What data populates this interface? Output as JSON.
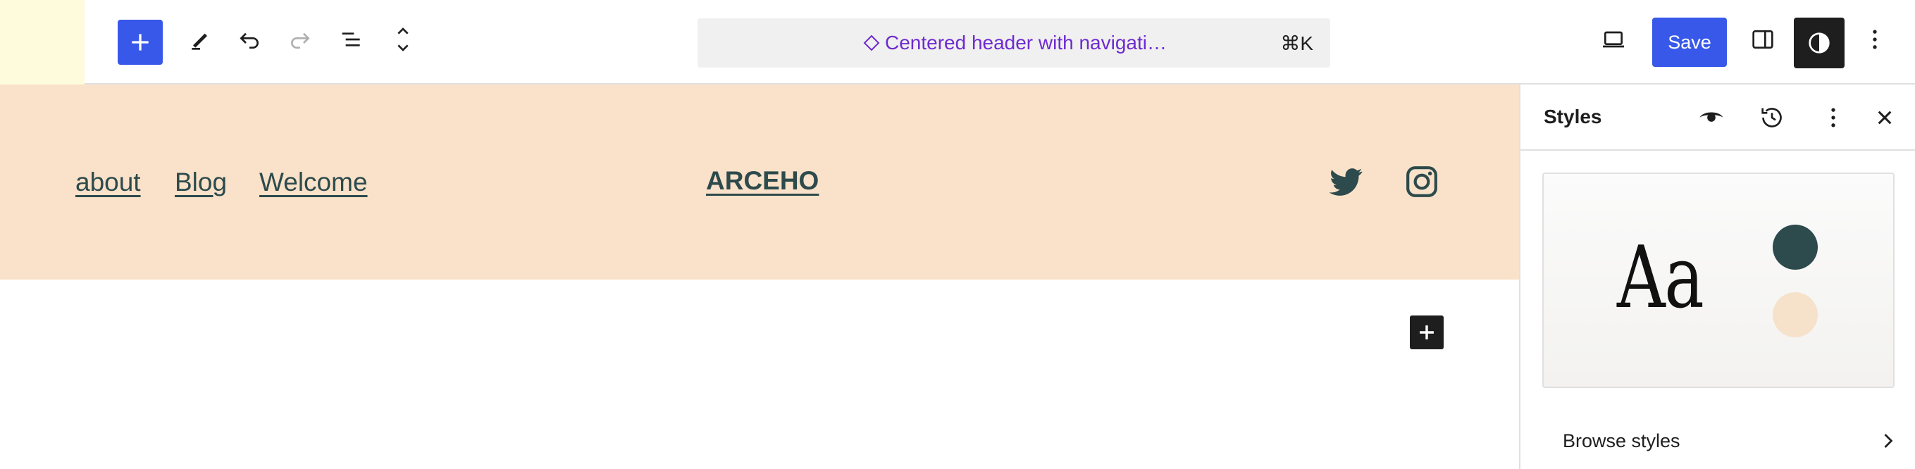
{
  "toolbar": {
    "document_title": "Centered header with navigati…",
    "shortcut": "⌘K",
    "save_label": "Save"
  },
  "canvas": {
    "nav_links": [
      "about",
      "Blog",
      "Welcome"
    ],
    "site_title": "ARCEHO",
    "social_icons": [
      "twitter-icon",
      "instagram-icon"
    ]
  },
  "sidebar": {
    "title": "Styles",
    "preview_text": "Aa",
    "browse_label": "Browse styles"
  },
  "colors": {
    "accent": "#3858e9",
    "header_bg": "#f9e2c9",
    "text_dark": "#2d4a4c",
    "site_icon_bg": "#fefbdc",
    "doc_title": "#6e2bcf",
    "swatch_primary": "#2d4a4c",
    "swatch_secondary": "#f6e1ca"
  }
}
